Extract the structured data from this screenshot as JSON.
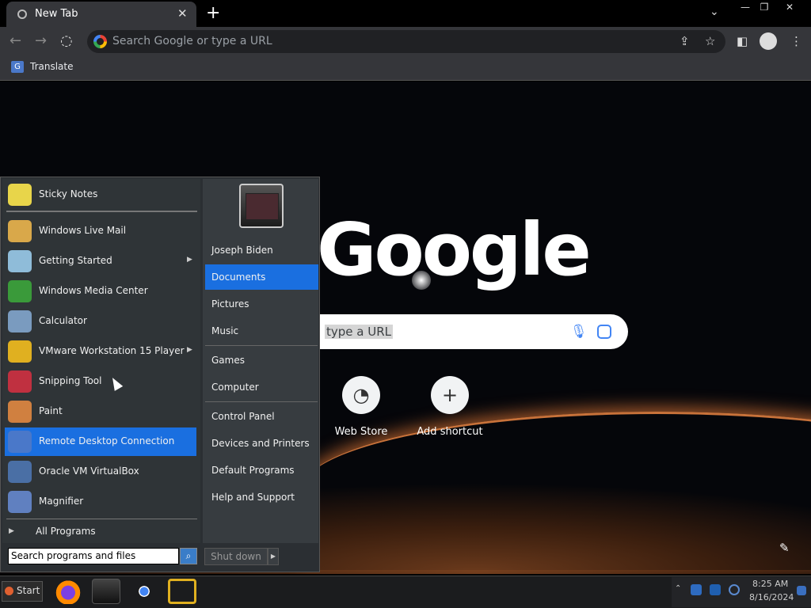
{
  "browser": {
    "tab_title": "New Tab",
    "omnibox_placeholder": "Search Google or type a URL",
    "bookmark_label": "Translate"
  },
  "ntp": {
    "logo_text": "Google",
    "search_placeholder": "type a URL",
    "shortcuts": [
      {
        "label": "Web Store"
      },
      {
        "label": "Add shortcut"
      }
    ]
  },
  "start_menu": {
    "pinned": [
      {
        "label": "Sticky Notes",
        "icon": "sticky-notes-icon",
        "color": "#e8d54a"
      }
    ],
    "recent": [
      {
        "label": "Windows Live Mail",
        "icon": "mail-icon",
        "color": "#d9a84a",
        "arrow": false
      },
      {
        "label": "Getting Started",
        "icon": "getting-started-icon",
        "color": "#8fbcd9",
        "arrow": true
      },
      {
        "label": "Windows Media Center",
        "icon": "media-center-icon",
        "color": "#3a9a3a",
        "arrow": false
      },
      {
        "label": "Calculator",
        "icon": "calculator-icon",
        "color": "#7a9bbf",
        "arrow": false
      },
      {
        "label": "VMware Workstation 15 Player",
        "icon": "vmware-icon",
        "color": "#e0b020",
        "arrow": true
      },
      {
        "label": "Snipping Tool",
        "icon": "scissors-icon",
        "color": "#c03040",
        "arrow": false
      },
      {
        "label": "Paint",
        "icon": "paint-icon",
        "color": "#d08040",
        "arrow": false
      },
      {
        "label": "Remote Desktop Connection",
        "icon": "remote-desktop-icon",
        "color": "#4a78c9",
        "arrow": false,
        "selected": true
      },
      {
        "label": "Oracle VM VirtualBox",
        "icon": "virtualbox-icon",
        "color": "#4a6fa5",
        "arrow": false
      },
      {
        "label": "Magnifier",
        "icon": "magnifier-icon",
        "color": "#6080c0",
        "arrow": false
      }
    ],
    "all_programs": "All Programs",
    "search_placeholder": "Search programs and files",
    "right": [
      {
        "label": "Joseph Biden"
      },
      {
        "label": "Documents",
        "selected": true
      },
      {
        "label": "Pictures"
      },
      {
        "label": "Music"
      },
      {
        "label": "Games"
      },
      {
        "label": "Computer"
      },
      {
        "label": "Control Panel"
      },
      {
        "label": "Devices and Printers"
      },
      {
        "label": "Default Programs"
      },
      {
        "label": "Help and Support"
      }
    ],
    "shutdown_label": "Shut down"
  },
  "taskbar": {
    "start_label": "Start",
    "clock_time": "8:25 AM",
    "clock_date": "8/16/2024"
  }
}
